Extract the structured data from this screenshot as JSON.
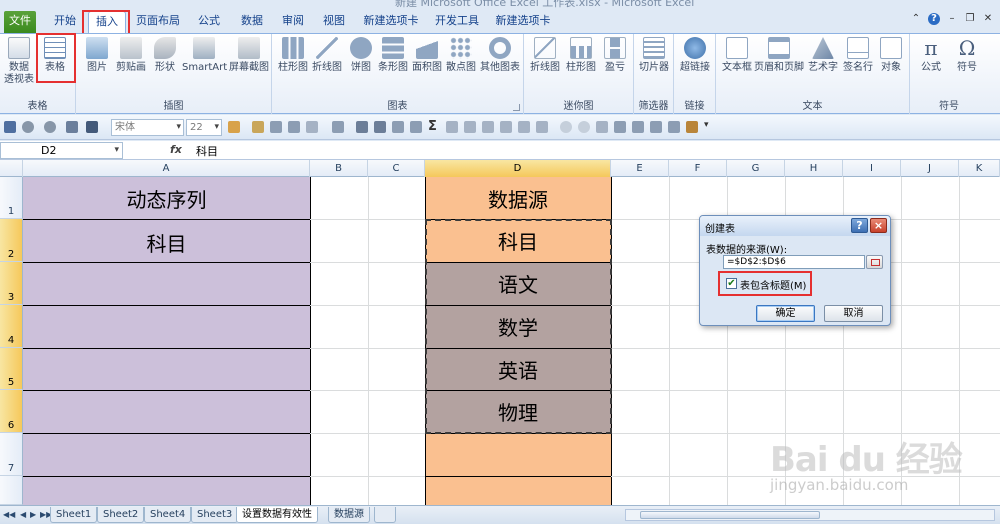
{
  "window": {
    "title": "新建 Microsoft Office Excel 工作表.xlsx - Microsoft Excel"
  },
  "ribbon_tabs": [
    "文件",
    "开始",
    "插入",
    "页面布局",
    "公式",
    "数据",
    "审阅",
    "视图",
    "新建选项卡",
    "开发工具",
    "新建选项卡"
  ],
  "active_tab": "插入",
  "ribbon_groups": {
    "tables": {
      "label": "表格",
      "buttons": [
        "数据\n透视表",
        "表格"
      ]
    },
    "illustrations": {
      "label": "插图",
      "buttons": [
        "图片",
        "剪贴画",
        "形状",
        "SmartArt",
        "屏幕截图"
      ]
    },
    "charts": {
      "label": "图表",
      "buttons": [
        "柱形图",
        "折线图",
        "饼图",
        "条形图",
        "面积图",
        "散点图",
        "其他图表"
      ]
    },
    "sparklines": {
      "label": "迷你图",
      "buttons": [
        "折线图",
        "柱形图",
        "盈亏"
      ]
    },
    "filter": {
      "label": "筛选器",
      "buttons": [
        "切片器"
      ]
    },
    "links": {
      "label": "链接",
      "buttons": [
        "超链接"
      ]
    },
    "text": {
      "label": "文本",
      "buttons": [
        "文本框",
        "页眉和页脚",
        "艺术字",
        "签名行",
        "对象"
      ]
    },
    "symbols": {
      "label": "符号",
      "buttons": [
        "公式",
        "符号"
      ]
    }
  },
  "toolbar": {
    "font_name": "宋体",
    "font_size": "22",
    "sigma": "Σ"
  },
  "formula_bar": {
    "name_box": "D2",
    "fx": "fx",
    "value": "科目"
  },
  "columns": [
    "A",
    "B",
    "C",
    "D",
    "E",
    "F",
    "G",
    "H",
    "I",
    "J",
    "K"
  ],
  "selected_column": "D",
  "rows": [
    "1",
    "2",
    "3",
    "4",
    "5",
    "6",
    "7"
  ],
  "cells": {
    "A1": "动态序列",
    "A2": "科目",
    "D1": "数据源",
    "D2": "科目",
    "D3": "语文",
    "D4": "数学",
    "D5": "英语",
    "D6": "物理"
  },
  "colors": {
    "purple_fill": "#ccc0da",
    "orange_fill": "#fac090",
    "gray_selection": "#b3a2a0",
    "highlight_red": "#e53030"
  },
  "dialog": {
    "title": "创建表",
    "help": "?",
    "close": "×",
    "source_label": "表数据的来源(W):",
    "source_value": "=$D$2:$D$6",
    "has_headers_label": "表包含标题(M)",
    "has_headers_checked": true,
    "check_mark": "✔",
    "ok": "确定",
    "cancel": "取消"
  },
  "sheet_tabs": [
    "Sheet1",
    "Sheet2",
    "Sheet4",
    "Sheet3",
    "设置数据有效性",
    "数据源"
  ],
  "active_sheet": "设置数据有效性",
  "watermark": {
    "text": "Bai du 经验",
    "url": "jingyan.baidu.com"
  }
}
